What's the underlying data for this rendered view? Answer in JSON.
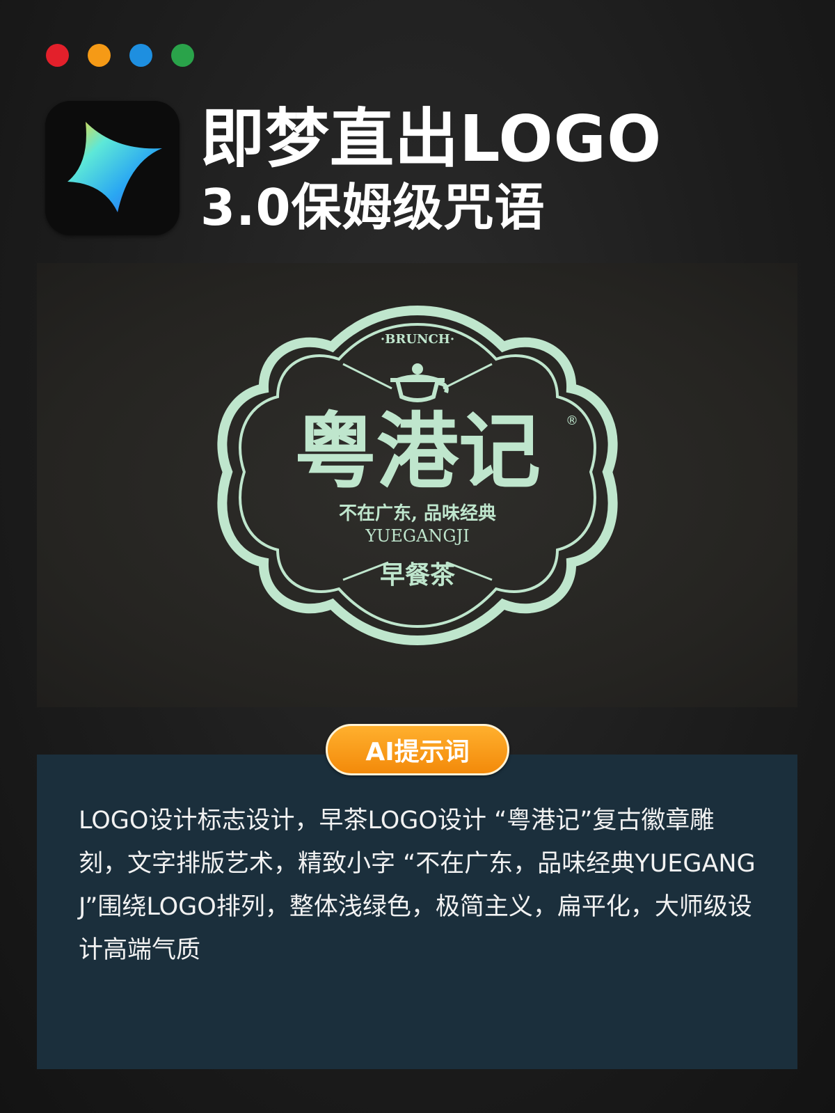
{
  "window_dots": [
    {
      "name": "red",
      "color": "#e3202b"
    },
    {
      "name": "orange",
      "color": "#f59a16"
    },
    {
      "name": "blue",
      "color": "#1e8fe0"
    },
    {
      "name": "green",
      "color": "#2aa34a"
    }
  ],
  "app_icon": "jimeng-app-icon",
  "header": {
    "title": "即梦直出LOGO",
    "subtitle": "3.0保姆级咒语"
  },
  "logo": {
    "top_text": "·BRUNCH·",
    "brand_name": "粤港记",
    "registered_mark": "®",
    "slogan": "不在广东, 品味经典",
    "pinyin": "YUEGANGJI",
    "bottom_text": "早餐茶",
    "icon": "teapot-icon",
    "color": "#bfe6cd"
  },
  "badge": {
    "label": "AI提示词"
  },
  "prompt": {
    "text": "LOGO设计标志设计，早茶LOGO设计 “粤港记”复古徽章雕刻，文字排版艺术，精致小字 “不在广东，品味经典YUEGANGJ”围绕LOGO排列，整体浅绿色，极简主义，扁平化，大师级设计高端气质"
  },
  "colors": {
    "accent_orange": "#f59a16",
    "prompt_bg": "#1b2f3c"
  }
}
